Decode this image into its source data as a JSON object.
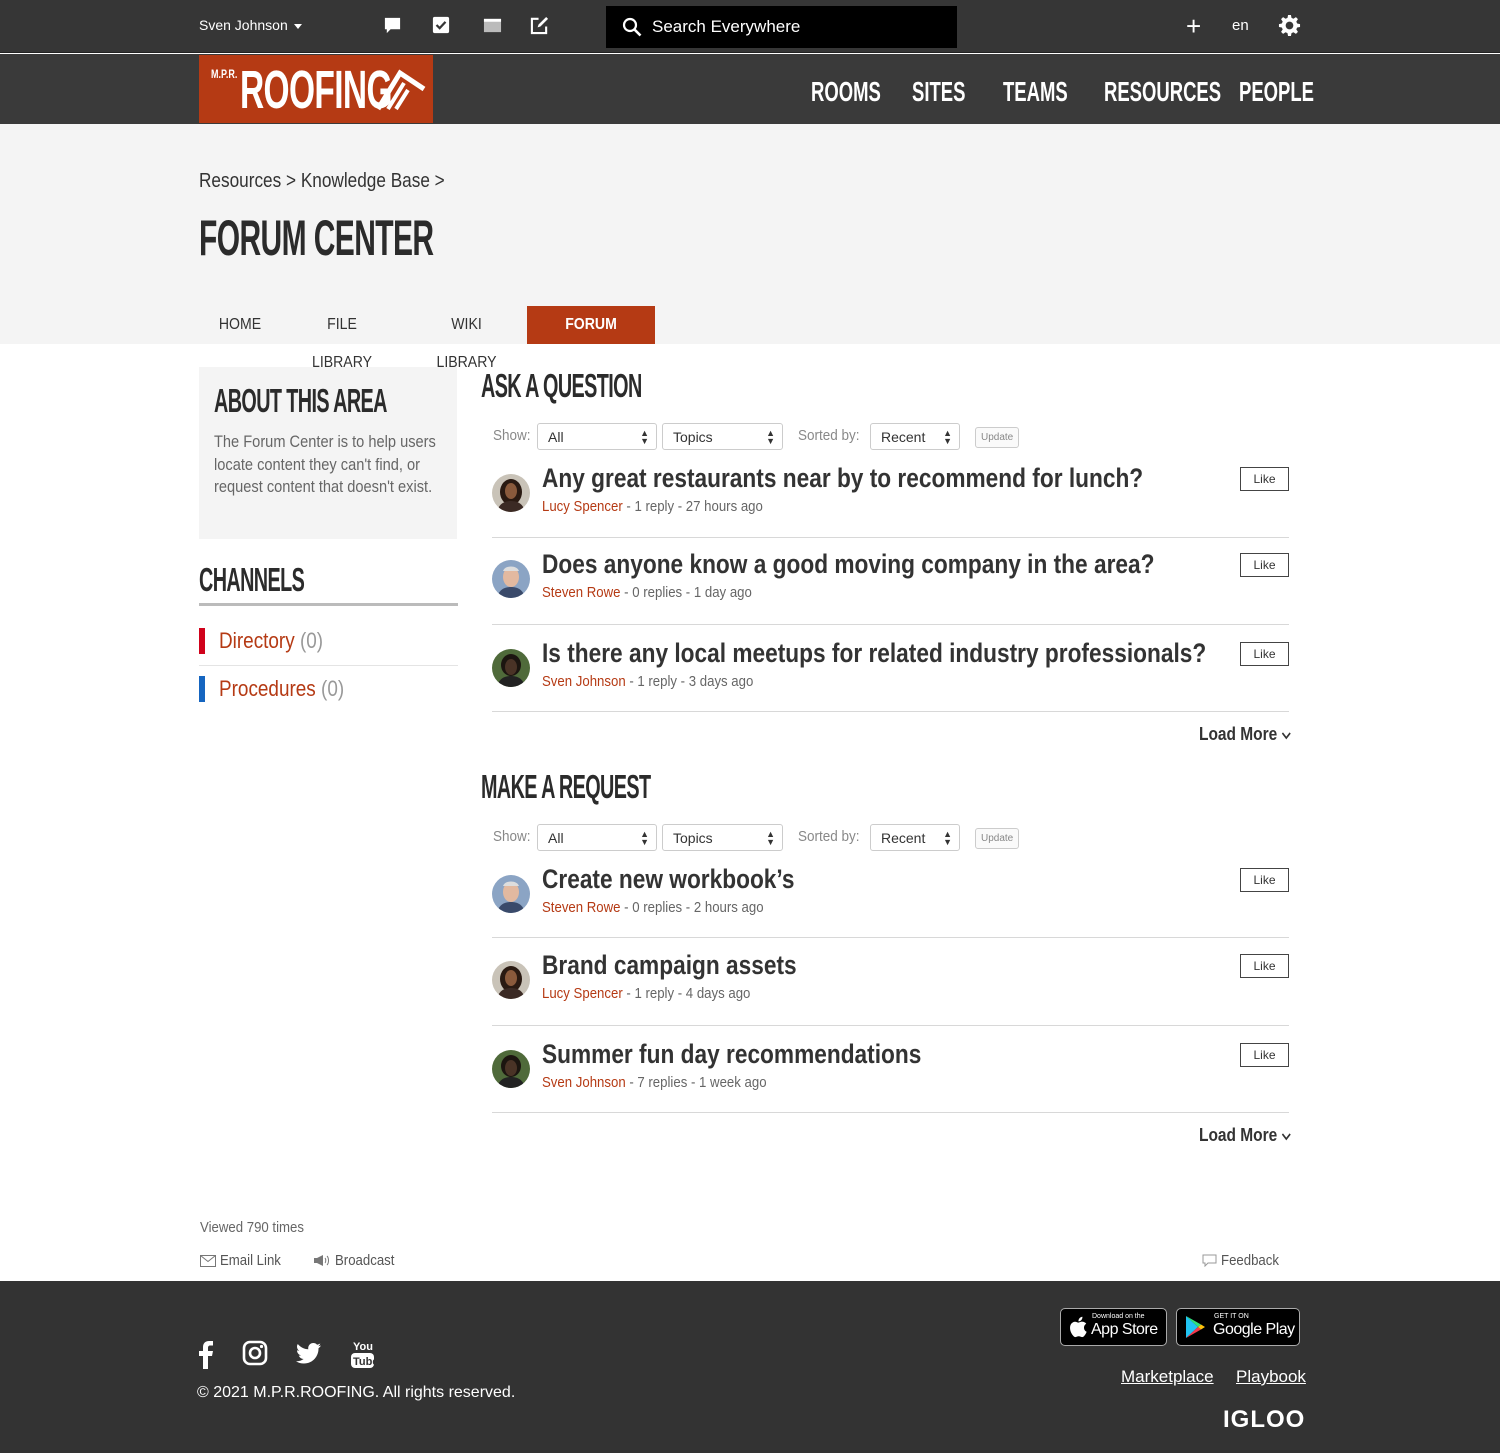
{
  "topbar": {
    "user": "Sven Johnson",
    "search_placeholder": "Search Everywhere",
    "lang": "en",
    "icons": [
      "chat-icon",
      "task-icon",
      "inbox-icon",
      "compose-icon"
    ]
  },
  "brand": {
    "mpr": "M.P.R.",
    "name": "ROOFING",
    "color": "#b53a14"
  },
  "nav": [
    "ROOMS",
    "SITES",
    "TEAMS",
    "RESOURCES",
    "PEOPLE"
  ],
  "breadcrumb": "Resources > Knowledge Base >",
  "page_title": "FORUM CENTER",
  "tabs": [
    "HOME",
    "FILE LIBRARY",
    "WIKI LIBRARY",
    "FORUM CENTER"
  ],
  "active_tab": "FORUM CENTER",
  "about": {
    "title": "ABOUT THIS AREA",
    "text": "The Forum Center is to help users locate content they can't find, or request content that doesn't exist."
  },
  "channels": {
    "title": "CHANNELS",
    "items": [
      {
        "name": "Directory",
        "count": "(0)",
        "color": "#d0021b"
      },
      {
        "name": "Procedures",
        "count": "(0)",
        "color": "#1565c0"
      }
    ]
  },
  "filters": {
    "show_label": "Show:",
    "show_value": "All",
    "topics_value": "Topics",
    "sorted_label": "Sorted by:",
    "sorted_value": "Recent",
    "update_label": "Update"
  },
  "like_label": "Like",
  "load_more": "Load More",
  "questions": {
    "title": "ASK A QUESTION",
    "posts": [
      {
        "title": "Any great restaurants near by to recommend for lunch?",
        "author": "Lucy Spencer",
        "info": " - 1 reply - 27 hours ago"
      },
      {
        "title": "Does anyone know a good moving company in the area?",
        "author": "Steven Rowe",
        "info": " - 0 replies - 1 day ago"
      },
      {
        "title": "Is there any local meetups for related industry professionals?",
        "author": "Sven Johnson",
        "info": " - 1 reply - 3 days ago"
      }
    ]
  },
  "requests": {
    "title": "MAKE A REQUEST",
    "posts": [
      {
        "title": "Create new workbook’s",
        "author": "Steven Rowe",
        "info": " - 0 replies - 2 hours ago"
      },
      {
        "title": "Brand campaign assets",
        "author": "Lucy Spencer",
        "info": " - 1 reply - 4 days ago"
      },
      {
        "title": "Summer fun day recommendations",
        "author": "Sven Johnson",
        "info": " - 7 replies - 1 week ago"
      }
    ]
  },
  "footer_meta": {
    "viewed": "Viewed 790 times",
    "email_link": "Email Link",
    "broadcast": "Broadcast",
    "feedback": "Feedback"
  },
  "footer": {
    "copyright": "© 2021 M.P.R.ROOFING. All rights reserved.",
    "app_store_small": "Download on the",
    "app_store_big": "App Store",
    "google_small": "GET IT ON",
    "google_big": "Google Play",
    "marketplace": "Marketplace",
    "playbook": "Playbook",
    "igloo": "IGLOO",
    "social": [
      "facebook-icon",
      "instagram-icon",
      "twitter-icon",
      "youtube-icon"
    ]
  }
}
